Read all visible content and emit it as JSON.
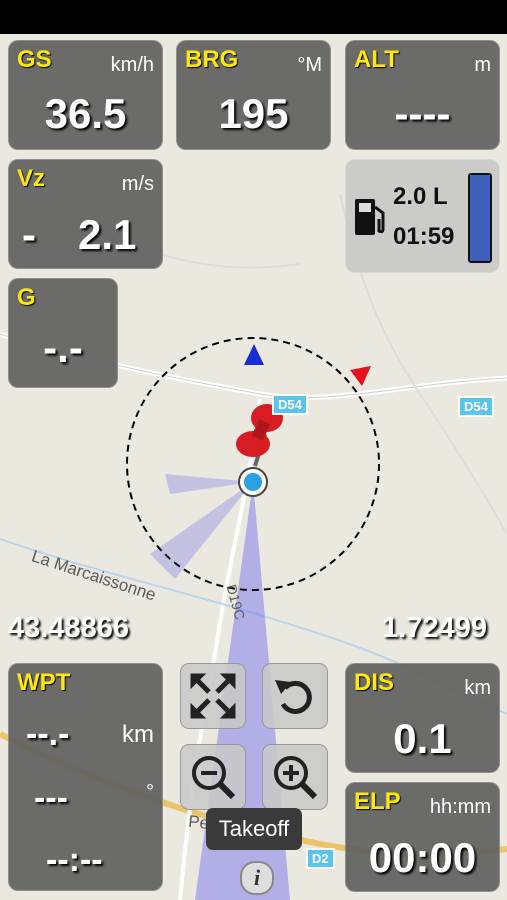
{
  "gs": {
    "label": "GS",
    "unit": "km/h",
    "value": "36.5"
  },
  "brg": {
    "label": "BRG",
    "unit": "°M",
    "value": "195"
  },
  "alt": {
    "label": "ALT",
    "unit": "m",
    "value": "----"
  },
  "vz": {
    "label": "Vz",
    "unit": "m/s",
    "value": "-",
    "value2": "2.1"
  },
  "fuel": {
    "volume": "2.0 L",
    "time": "01:59",
    "level": 1.0,
    "icon": "fuel-pump-icon"
  },
  "g": {
    "label": "G",
    "value": "-.-"
  },
  "coords": {
    "lat": "43.48866",
    "lon": "1.72499"
  },
  "wpt": {
    "label": "WPT",
    "unit": "km",
    "distance": "--.-",
    "bearing": "---",
    "bearing_unit": "°",
    "time": "--:--"
  },
  "dis": {
    "label": "DIS",
    "unit": "km",
    "value": "0.1"
  },
  "elp": {
    "label": "ELP",
    "unit": "hh:mm",
    "value": "00:00"
  },
  "takeoff_label": "Takeoff",
  "map": {
    "road_labels": [
      "D54",
      "D54",
      "D2"
    ],
    "place_labels": [
      "La Marcaissonne",
      "Peyrecave",
      "D19C"
    ]
  },
  "colors": {
    "accent": "#ffe80a",
    "panel": "#5f5f5f",
    "fuel_bar": "#3f5fbd",
    "track": "#6b6bf0"
  }
}
